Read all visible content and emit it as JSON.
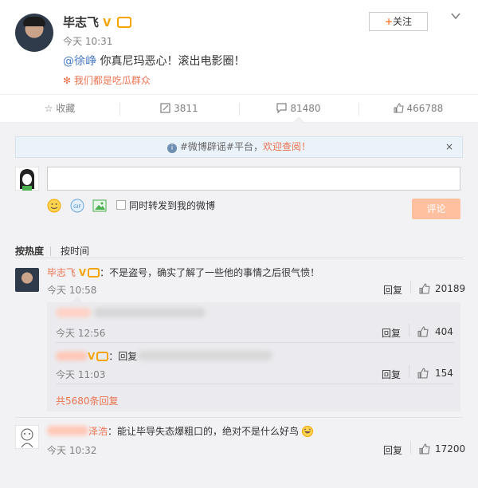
{
  "post": {
    "author": "毕志飞",
    "time": "今天 10:31",
    "mention": "@徐峥",
    "text": " 你真尼玛恶心！滚出电影圈！",
    "source": "我们都是吃瓜群众",
    "follow_label": "关注"
  },
  "actions": {
    "favorite": "收藏",
    "repost": "3811",
    "comment": "81480",
    "like": "466788"
  },
  "notice": {
    "prefix": "#微博辟谣#平台，",
    "link": "欢迎查阅！",
    "close": "×"
  },
  "compose": {
    "repost_label": "同时转发到我的微博",
    "submit_label": "评论"
  },
  "sort": {
    "hot": "按热度",
    "time": "按时间"
  },
  "comments": [
    {
      "name": "毕志飞",
      "text": "：不是盗号，确实了解了一些他的事情之后很气愤！",
      "time": "今天 10:58",
      "reply": "回复",
      "likes": "20189"
    },
    {
      "name": "用户",
      "text": "：能让毕导失态爆粗口的，绝对不是什么好鸟",
      "time": "今天 10:32",
      "reply": "回复",
      "likes": "17200",
      "name_tail": "泽浩"
    }
  ],
  "sub_replies": [
    {
      "time": "今天 12:56",
      "reply": "回复",
      "likes": "404"
    },
    {
      "prefix": "：回复",
      "time": "今天 11:03",
      "reply": "回复",
      "likes": "154"
    }
  ],
  "more_replies": "共5680条回复",
  "colors": {
    "orange": "#eb7350",
    "badge": "#f4a300",
    "panel": "#f2f2f5",
    "submit": "#ffc09f"
  }
}
